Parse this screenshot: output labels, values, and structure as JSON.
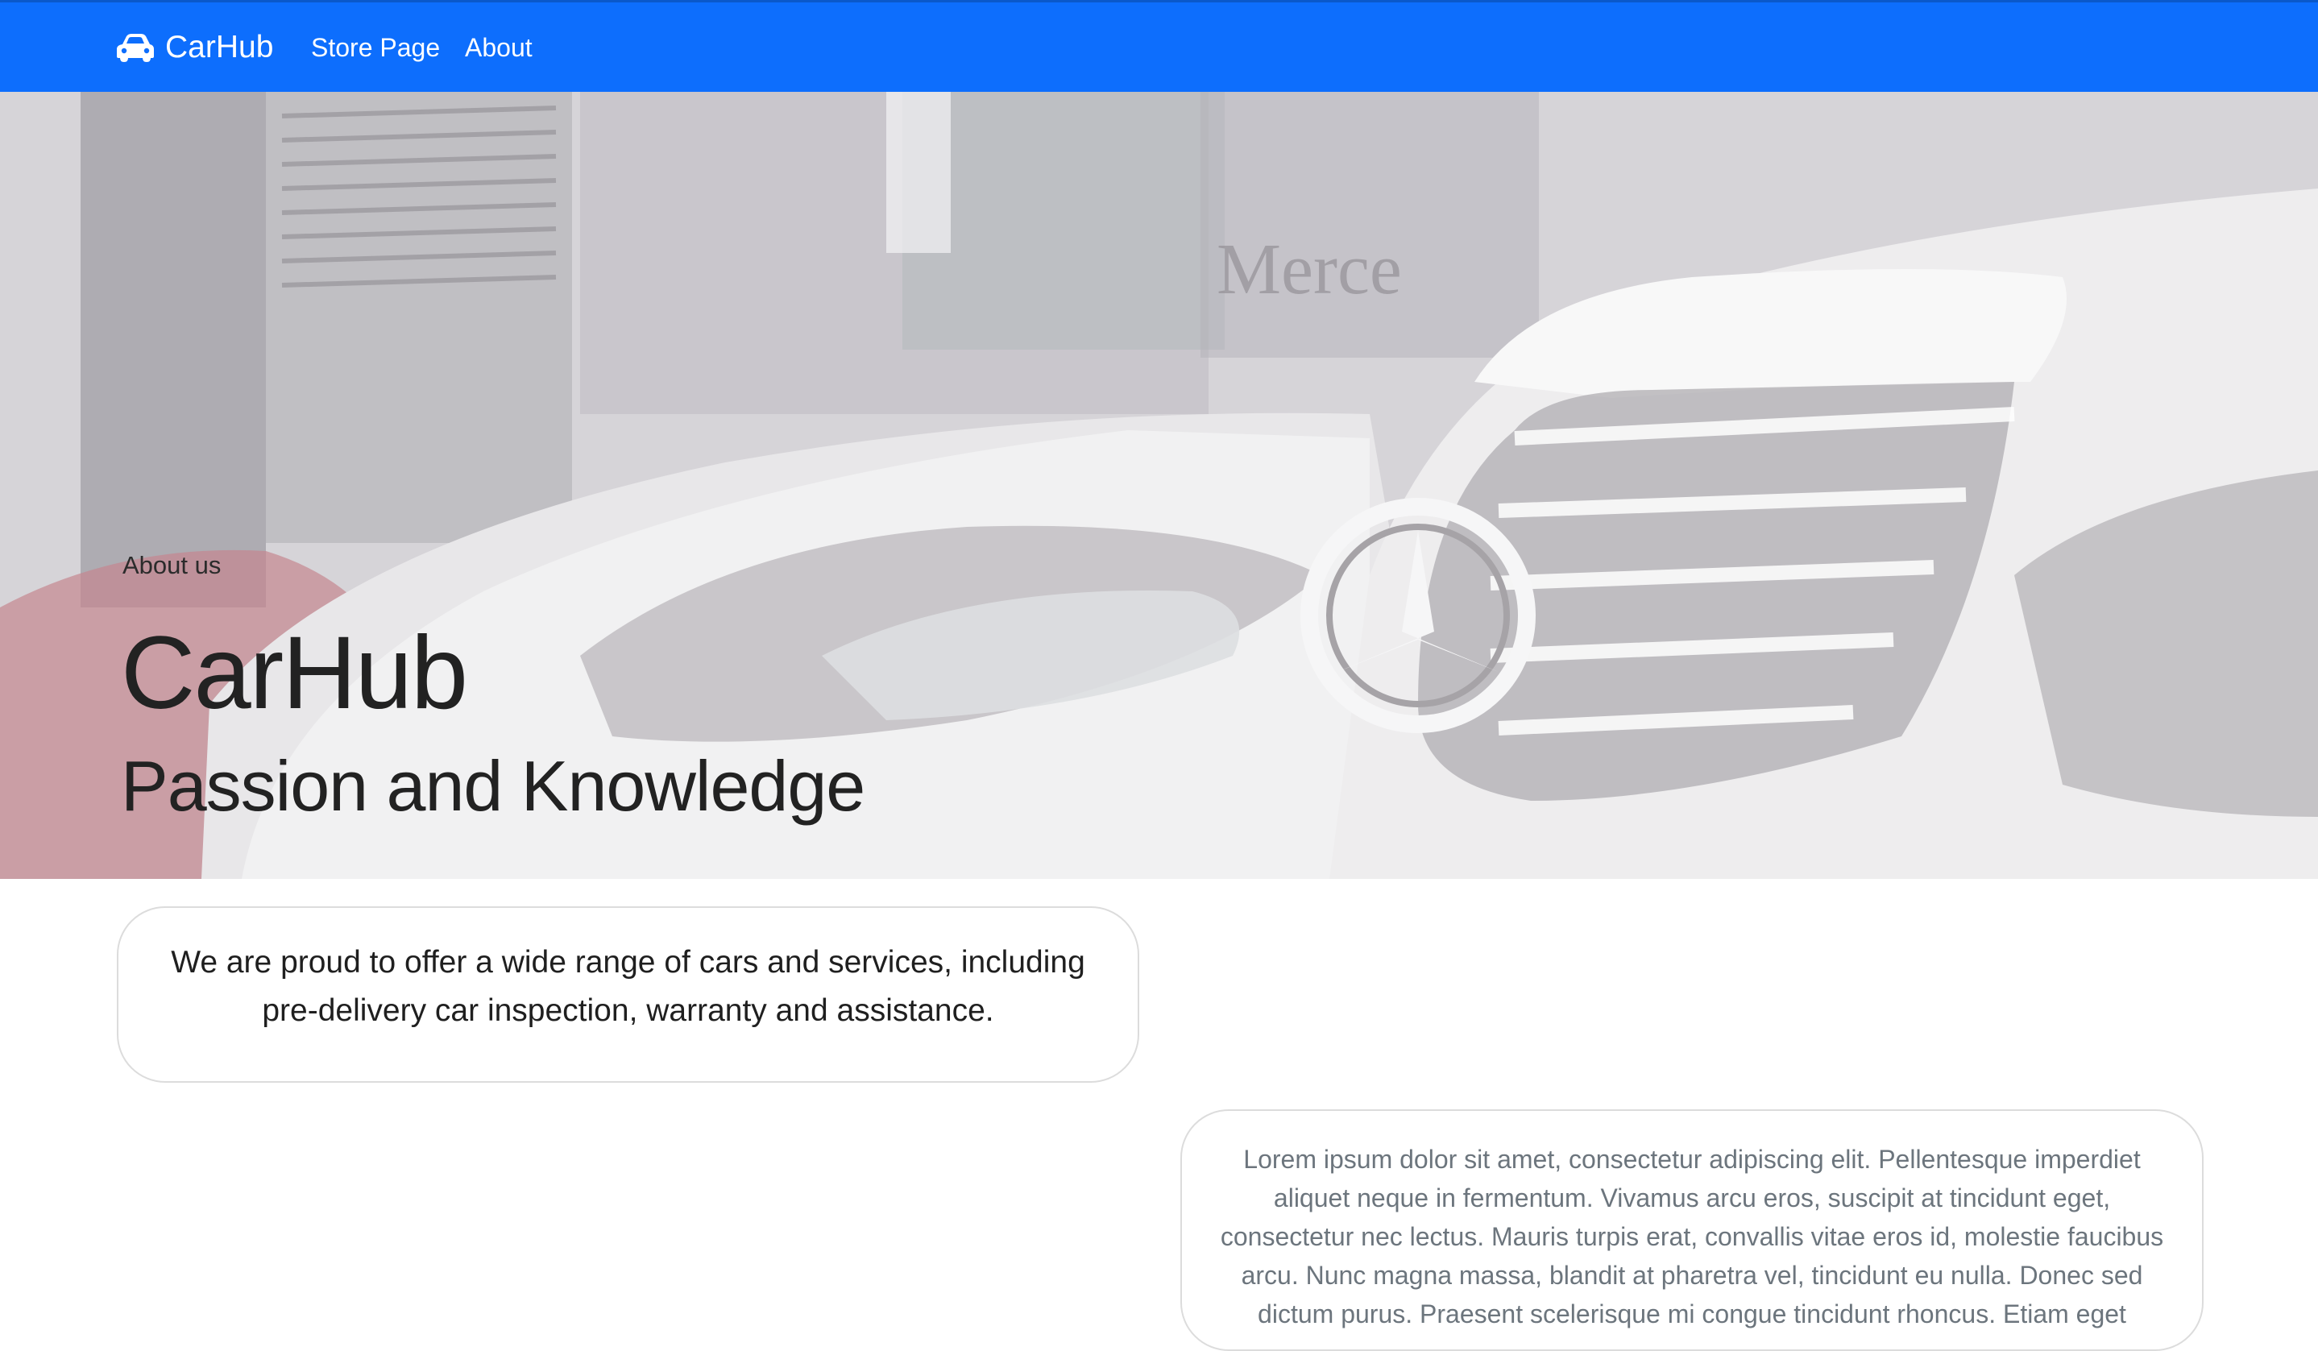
{
  "navbar": {
    "brand": "CarHub",
    "brand_icon": "car-icon",
    "links": [
      "Store Page",
      "About"
    ],
    "color": "#0d6efd"
  },
  "hero": {
    "subtitle": "About us",
    "title": "CarHub",
    "tagline": "Passion and Knowledge"
  },
  "intro_card": {
    "text": "We are proud to offer a wide range of cars and services, including pre-delivery car inspection, warranty and assistance."
  },
  "lorem_card": {
    "text": "Lorem ipsum dolor sit amet, consectetur adipiscing elit. Pellentesque imperdiet aliquet neque in fermentum. Vivamus arcu eros, suscipit at tincidunt eget, consectetur nec lectus. Mauris turpis erat, convallis vitae eros id, molestie faucibus arcu. Nunc magna massa, blandit at pharetra vel, tincidunt eu nulla. Donec sed dictum purus. Praesent scelerisque mi congue tincidunt rhoncus. Etiam eget"
  }
}
